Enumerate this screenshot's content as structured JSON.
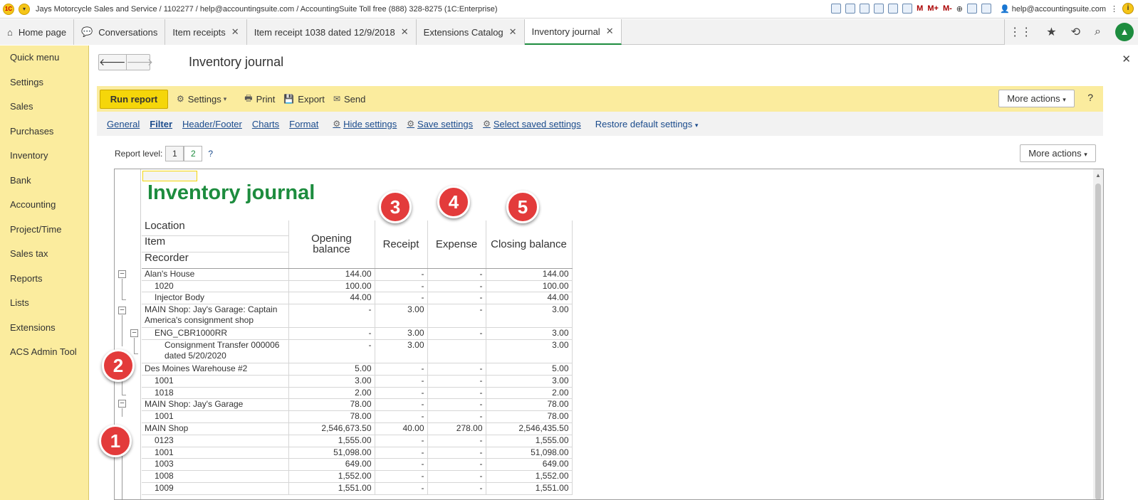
{
  "titlebar": {
    "text": "Jays Motorcycle Sales and Service / 1102277 / help@accountingsuite.com / AccountingSuite Toll free (888) 328-8275  (1C:Enterprise)",
    "m": "M",
    "mplus": "M+",
    "mminus": "M-",
    "user": "help@accountingsuite.com"
  },
  "tabs": {
    "home": "Home page",
    "conversations": "Conversations",
    "item_receipts": "Item receipts",
    "item_receipt_1038": "Item receipt 1038 dated 12/9/2018",
    "extensions_catalog": "Extensions Catalog",
    "inventory_journal": "Inventory journal"
  },
  "sidebar": {
    "items": [
      "Quick menu",
      "Settings",
      "Sales",
      "Purchases",
      "Inventory",
      "Bank",
      "Accounting",
      "Project/Time",
      "Sales tax",
      "Reports",
      "Lists",
      "Extensions",
      "ACS Admin Tool"
    ]
  },
  "page": {
    "title": "Inventory journal"
  },
  "cmdbar": {
    "run_report": "Run report",
    "settings": "Settings",
    "print": "Print",
    "export": "Export",
    "send": "Send",
    "more_actions": "More actions",
    "help": "?"
  },
  "linkbar": {
    "general": "General",
    "filter": "Filter",
    "header_footer": "Header/Footer",
    "charts": "Charts",
    "format": "Format",
    "hide_settings": "Hide settings",
    "save_settings": "Save settings",
    "select_saved": "Select saved settings",
    "restore": "Restore default settings"
  },
  "report_level": {
    "label": "Report level:",
    "l1": "1",
    "l2": "2",
    "q": "?",
    "more_actions": "More actions"
  },
  "report": {
    "title": "Inventory journal",
    "header": {
      "location": "Location",
      "item": "Item",
      "recorder": "Recorder",
      "opening": "Opening balance",
      "receipt": "Receipt",
      "expense": "Expense",
      "closing": "Closing balance"
    },
    "rows": [
      {
        "name": "Alan's House",
        "open": "144.00",
        "rec": "-",
        "exp": "-",
        "close": "144.00"
      },
      {
        "name": "1020",
        "open": "100.00",
        "rec": "-",
        "exp": "-",
        "close": "100.00"
      },
      {
        "name": "Injector Body",
        "open": "44.00",
        "rec": "-",
        "exp": "-",
        "close": "44.00"
      },
      {
        "name": "MAIN Shop: Jay's Garage: Captain America's consignment shop",
        "open": "-",
        "rec": "3.00",
        "exp": "-",
        "close": "3.00"
      },
      {
        "name": "ENG_CBR1000RR",
        "open": "-",
        "rec": "3.00",
        "exp": "-",
        "close": "3.00"
      },
      {
        "name": "Consignment Transfer 000006 dated 5/20/2020",
        "open": "-",
        "rec": "3.00",
        "exp": "",
        "close": "3.00"
      },
      {
        "name": "Des Moines Warehouse #2",
        "open": "5.00",
        "rec": "-",
        "exp": "-",
        "close": "5.00"
      },
      {
        "name": "1001",
        "open": "3.00",
        "rec": "-",
        "exp": "-",
        "close": "3.00"
      },
      {
        "name": "1018",
        "open": "2.00",
        "rec": "-",
        "exp": "-",
        "close": "2.00"
      },
      {
        "name": "MAIN Shop: Jay's Garage",
        "open": "78.00",
        "rec": "-",
        "exp": "-",
        "close": "78.00"
      },
      {
        "name": "1001",
        "open": "78.00",
        "rec": "-",
        "exp": "-",
        "close": "78.00"
      },
      {
        "name": "MAIN Shop",
        "open": "2,546,673.50",
        "rec": "40.00",
        "exp": "278.00",
        "close": "2,546,435.50"
      },
      {
        "name": "0123",
        "open": "1,555.00",
        "rec": "-",
        "exp": "-",
        "close": "1,555.00"
      },
      {
        "name": "1001",
        "open": "51,098.00",
        "rec": "-",
        "exp": "-",
        "close": "51,098.00"
      },
      {
        "name": "1003",
        "open": "649.00",
        "rec": "-",
        "exp": "-",
        "close": "649.00"
      },
      {
        "name": "1008",
        "open": "1,552.00",
        "rec": "-",
        "exp": "-",
        "close": "1,552.00"
      },
      {
        "name": "1009",
        "open": "1,551.00",
        "rec": "-",
        "exp": "-",
        "close": "1,551.00"
      }
    ]
  },
  "badges": {
    "b1": "1",
    "b2": "2",
    "b3": "3",
    "b4": "4",
    "b5": "5"
  },
  "colors": {
    "accent_green": "#1d8c3e",
    "sidebar_yellow": "#fbec9e",
    "run_button": "#f5d60a",
    "badge_red": "#e33b3b"
  }
}
